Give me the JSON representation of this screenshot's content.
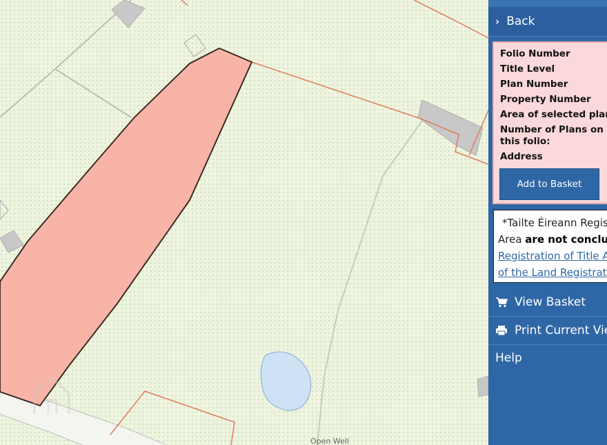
{
  "map": {
    "label": "Open Well",
    "colors": {
      "background": "#eef4df",
      "selected_plot_fill": "#f9b4a8",
      "boundary_line": "#e07a5f",
      "road_line": "#b9bdb8",
      "water": "#cfe2f5",
      "building": "#c8c8c8"
    }
  },
  "panel": {
    "back_label": "Back",
    "info_fields": [
      "Folio Number",
      "Title Level",
      "Plan Number",
      "Property Number",
      "Area of selected plans",
      "Number of Plans on this folio:",
      "Address"
    ],
    "add_to_basket": "Add to Basket",
    "notice": {
      "line1": "*Tailte Éireann Registra",
      "line2_prefix": "Area ",
      "line2_bold": "are not conclusiv",
      "link1": "Registration of Title A",
      "link2": "of the Land Registrat"
    },
    "menu": [
      {
        "label": "View Basket",
        "icon": "cart-icon"
      },
      {
        "label": "Print Current View",
        "icon": "printer-icon"
      },
      {
        "label": "Help",
        "icon": ""
      }
    ],
    "colors": {
      "panel_bg": "#2f67a6",
      "info_bg": "#fbd9da",
      "info_border": "#f3a9ae"
    }
  }
}
